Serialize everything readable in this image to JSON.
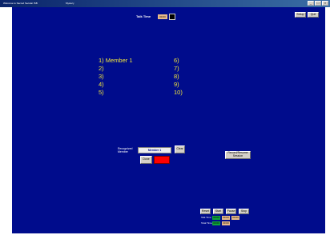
{
  "window": {
    "title": "Welcome to Sacred Secular ISB",
    "subtitle": "Mystery",
    "buttons": [
      "_",
      "□",
      "×"
    ]
  },
  "header": {
    "talk_time_label": "Talk Time",
    "talk_time_value": "00:00"
  },
  "top_right": {
    "button1": "Setup",
    "button2": "Quit"
  },
  "members": {
    "left": [
      "1)  Member 1",
      "2)",
      "3)",
      "4)",
      "5)"
    ],
    "right": [
      "6)",
      "7)",
      "8)",
      "9)",
      "10)"
    ]
  },
  "recognized": {
    "label": "Recognized Member",
    "value": "Member 1",
    "clear_button": "Clear",
    "done_button": "Done",
    "status_value": ""
  },
  "right_panel": {
    "button": "Record/Resume Session"
  },
  "bottom_panel": {
    "buttons": [
      "Reset",
      "Start",
      "Pause",
      "Stop"
    ],
    "talk_time_label": "Talk Time",
    "total_time_label": "Total Time",
    "talk_values": [
      "00:00",
      "00:00",
      "00:00"
    ],
    "total_values": [
      "00:00",
      "00:00"
    ]
  },
  "colors": {
    "background": "#000c8c",
    "member_text": "#f1e63b",
    "alert_red": "#ff0000",
    "timer_green": "#0fa33a",
    "timer_tan": "#e7b98a"
  }
}
